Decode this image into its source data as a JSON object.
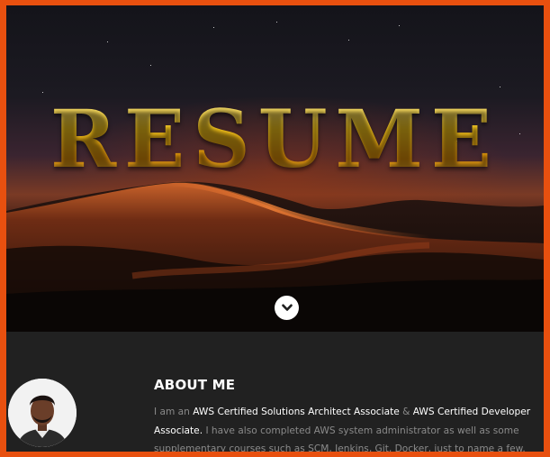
{
  "hero": {
    "title": "RESUME",
    "scroll_icon": "chevron-down-icon"
  },
  "about": {
    "heading": "ABOUT ME",
    "text": {
      "intro": "I am an ",
      "cert1": "AWS Certified Solutions Architect Associate",
      "sep": " & ",
      "cert2": "AWS Certified Developer Associate.",
      "rest": " I have also completed AWS system administrator as well as some supplementary courses such as SCM, Jenkins, Git, Docker, just to name a few."
    }
  },
  "colors": {
    "frame_border": "#e8500f",
    "title_gold": "#f2c21a",
    "section_bg": "#212121",
    "highlight_text": "#ffffff",
    "body_text": "#8a8a8a"
  }
}
